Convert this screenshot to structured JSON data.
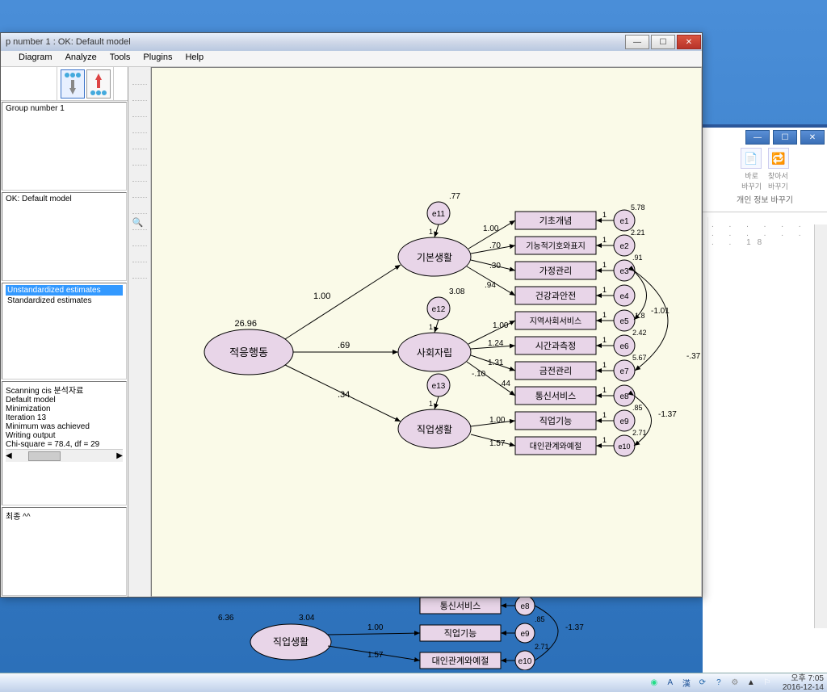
{
  "window": {
    "title": "p number 1 : OK: Default model"
  },
  "menubar": [
    "",
    "Diagram",
    "Analyze",
    "Tools",
    "Plugins",
    "Help"
  ],
  "groups_label": "Group number 1",
  "status_label": "OK: Default model",
  "estimates": {
    "unstd": "Unstandardized estimates",
    "std": "Standardized estimates"
  },
  "output_lines": [
    "Scanning cis 분석자료",
    "Default model",
    "Minimization",
    "   Iteration 13",
    "Minimum was achieved",
    "Writing output",
    "Chi-square = 78.4, df = 29"
  ],
  "bottom_note": "최종 ^^",
  "diagram": {
    "main": "적응행동",
    "main_variance": "26.96",
    "factors": {
      "f1": {
        "label": "기본생활",
        "load": "1.00",
        "e": "e11",
        "evar": ".77"
      },
      "f2": {
        "label": "사회자립",
        "load": ".69",
        "e": "e12",
        "evar": "3.08"
      },
      "f3": {
        "label": "직업생활",
        "load": ".34",
        "e": "e13",
        "evar": ""
      }
    },
    "observed": [
      {
        "label": "기초개념",
        "e": "e1",
        "load": "1.00",
        "evar": "5.78"
      },
      {
        "label": "기능적기호와표지",
        "e": "e2",
        "load": ".70",
        "evar": "2.21"
      },
      {
        "label": "가정관리",
        "e": "e3",
        "load": ".30",
        "evar": ".91"
      },
      {
        "label": "건강과안전",
        "e": "e4",
        "load": ".94",
        "evar": ""
      },
      {
        "label": "지역사회서비스",
        "e": "e5",
        "load": "1.00",
        "evar": "1.8"
      },
      {
        "label": "시간과측정",
        "e": "e6",
        "load": "1.24",
        "evar": "2.42"
      },
      {
        "label": "금전관리",
        "e": "e7",
        "load": "1.31",
        "evar": "5.67"
      },
      {
        "label": "통신서비스",
        "e": "e8",
        "load": ".44",
        "evar": ""
      },
      {
        "label": "직업기능",
        "e": "e9",
        "load": "1.00",
        "evar": ".85"
      },
      {
        "label": "대인관계와예절",
        "e": "e10",
        "load": "1.57",
        "evar": "2.71"
      }
    ],
    "extra_params": {
      "commu_intercept": "-.10"
    },
    "covariances": [
      {
        "val": "-1.01"
      },
      {
        "val": "-.37"
      },
      {
        "val": "-1.37"
      }
    ],
    "fixed1": "1"
  },
  "bg_window": {
    "group_title": "개인 정보 바꾸기",
    "btn1": "바로\n바꾸기",
    "btn2": "찾아서\n바꾸기",
    "help": "? ×",
    "doc_dots": ". . . . . . . . . . . . . . 18"
  },
  "bg_diagram": {
    "f3_label": "직업생활",
    "f3_variance": "3.04",
    "f3_load_prefix": "6.36",
    "items": [
      {
        "label": "통신서비스",
        "e": "e8",
        "load": ""
      },
      {
        "label": "직업기능",
        "e": "e9",
        "load": "1.00",
        "evar": ".85"
      },
      {
        "label": "대인관계와예절",
        "e": "e10",
        "load": "1.57",
        "evar": "2.71"
      }
    ],
    "cov": "-1.37"
  },
  "taskbar": {
    "ime": "A",
    "han": "漢",
    "time": "오후 7:05",
    "date": "2016-12-14"
  }
}
